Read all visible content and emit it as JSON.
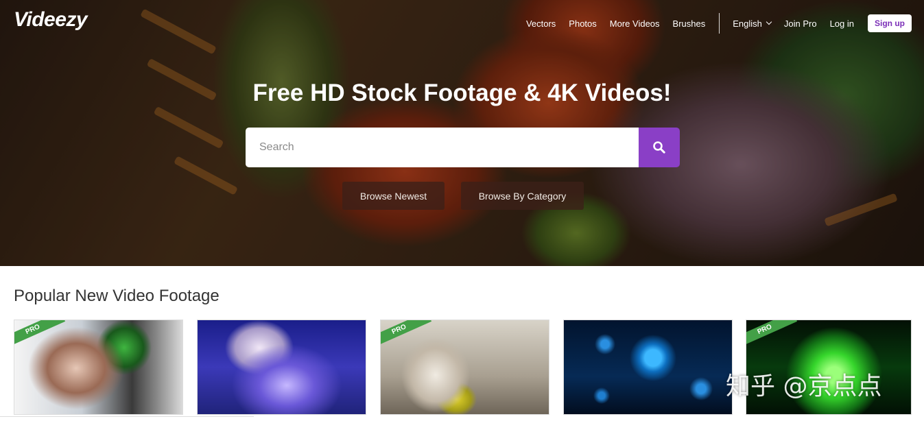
{
  "brand": {
    "logo": "Videezy"
  },
  "nav": {
    "links": [
      "Vectors",
      "Photos",
      "More Videos",
      "Brushes"
    ],
    "language": "English",
    "join_pro": "Join Pro",
    "login": "Log in",
    "signup": "Sign up"
  },
  "hero": {
    "headline": "Free HD Stock Footage & 4K Videos!",
    "search_placeholder": "Search",
    "browse_newest": "Browse Newest",
    "browse_category": "Browse By Category"
  },
  "section": {
    "title": "Popular New Video Footage"
  },
  "thumbnails": [
    {
      "badge": "PRO"
    },
    {
      "badge": ""
    },
    {
      "badge": "PRO"
    },
    {
      "badge": ""
    },
    {
      "badge": "PRO"
    }
  ],
  "watermark": "知乎 @京点点",
  "colors": {
    "accent_purple": "#8a3fc6",
    "pro_green": "#43a047"
  }
}
